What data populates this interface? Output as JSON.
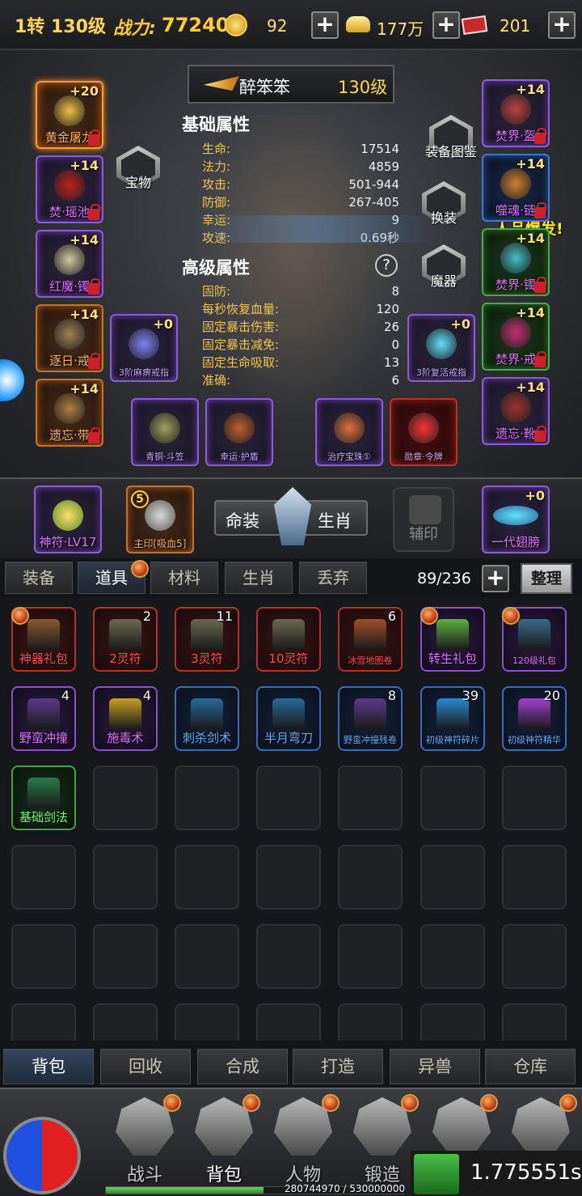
{
  "topbar": {
    "level": "1转 130级",
    "power_label": "战力:",
    "power_value": "77240",
    "currency1": "92",
    "gold": "177万",
    "voucher": "201"
  },
  "character": {
    "name": "醉笨笨",
    "level": "130级",
    "basic_title": "基础属性",
    "advanced_title": "高级属性",
    "help_icon_text": "?",
    "basic_stats": [
      {
        "k": "生命:",
        "v": "17514"
      },
      {
        "k": "法力:",
        "v": "4859"
      },
      {
        "k": "攻击:",
        "v": "501-944"
      },
      {
        "k": "防御:",
        "v": "267-405"
      },
      {
        "k": "幸运:",
        "v": "9"
      },
      {
        "k": "攻速:",
        "v": "0.69秒"
      }
    ],
    "advanced_stats": [
      {
        "k": "固防:",
        "v": "8"
      },
      {
        "k": "每秒恢复血量:",
        "v": "120"
      },
      {
        "k": "固定暴击伤害:",
        "v": "26"
      },
      {
        "k": "固定暴击减免:",
        "v": "0"
      },
      {
        "k": "固定生命吸取:",
        "v": "13"
      },
      {
        "k": "准确:",
        "v": "6"
      }
    ],
    "buttons": {
      "treasure": "宝物",
      "codex": "装备图鉴",
      "switch": "换装",
      "magic": "魔器"
    },
    "luck_banner": "人品爆发!"
  },
  "equip_left": [
    {
      "lvl": "+20",
      "name": "黄金屠龙"
    },
    {
      "lvl": "+14",
      "name": "焚·瑶池"
    },
    {
      "lvl": "+14",
      "name": "红魔·镯"
    },
    {
      "lvl": "+14",
      "name": "逐日·戒"
    },
    {
      "lvl": "+14",
      "name": "遗忘·带"
    }
  ],
  "equip_right": [
    {
      "lvl": "+14",
      "name": "焚界·盔"
    },
    {
      "lvl": "+14",
      "name": "噬魂·链"
    },
    {
      "lvl": "+14",
      "name": "焚界·镯"
    },
    {
      "lvl": "+14",
      "name": "焚界·戒"
    },
    {
      "lvl": "+14",
      "name": "遗忘·靴"
    }
  ],
  "equip_rings": [
    {
      "lvl": "+0",
      "name": "3阶麻痹戒指"
    },
    {
      "lvl": "+0",
      "name": "3阶复活戒指"
    }
  ],
  "equip_bottom": [
    {
      "name": "青铜·斗笠"
    },
    {
      "name": "幸运·护盾"
    },
    {
      "name": "治疗宝珠①"
    },
    {
      "name": "勋章·令牌"
    }
  ],
  "mid": {
    "talisman": "神符·LV17",
    "seal_num": "5",
    "seal": "主印[吸血5]",
    "fate_label": "命装",
    "zodiac_label": "生肖",
    "aux_seal": "辅印",
    "wings_lvl": "+0",
    "wings": "一代翅膀"
  },
  "bag_tabs": [
    "装备",
    "道具",
    "材料",
    "生肖",
    "丢弃"
  ],
  "bag_count": "89/236",
  "sort_label": "整理",
  "bag_items": [
    {
      "name": "神器礼包",
      "count": "",
      "color": "red",
      "ic": "#8a5a30"
    },
    {
      "name": "2灵符",
      "count": "2",
      "color": "red",
      "ic": "#6a6a50"
    },
    {
      "name": "3灵符",
      "count": "11",
      "color": "red",
      "ic": "#6a6a50"
    },
    {
      "name": "10灵符",
      "count": "",
      "color": "red",
      "ic": "#6a6a50"
    },
    {
      "name": "冰雪地图卷",
      "count": "6",
      "color": "red",
      "ic": "#a0502a"
    },
    {
      "name": "转生礼包",
      "count": "",
      "color": "purple",
      "ic": "#60b040"
    },
    {
      "name": "120级礼包",
      "count": "",
      "color": "purple",
      "ic": "#3a6a8a"
    },
    {
      "name": "野蛮冲撞",
      "count": "4",
      "color": "purple",
      "ic": "#5a3a8a"
    },
    {
      "name": "施毒术",
      "count": "4",
      "color": "purple",
      "ic": "#c8a020"
    },
    {
      "name": "刺杀剑术",
      "count": "",
      "color": "blue",
      "ic": "#2a6a9a"
    },
    {
      "name": "半月弯刀",
      "count": "",
      "color": "blue",
      "ic": "#2a6a9a"
    },
    {
      "name": "野蛮冲撞残卷",
      "count": "8",
      "color": "blue",
      "ic": "#5a3a8a"
    },
    {
      "name": "初级神符碎片",
      "count": "39",
      "color": "blue",
      "ic": "#2a8ad0"
    },
    {
      "name": "初级神符精华",
      "count": "20",
      "color": "blue",
      "ic": "#a040d0"
    },
    {
      "name": "基础剑法",
      "count": "",
      "color": "green",
      "ic": "#2a7a4a"
    }
  ],
  "sub_tabs": [
    "背包",
    "回收",
    "合成",
    "打造",
    "异兽",
    "仓库"
  ],
  "nav": [
    "战斗",
    "背包",
    "人物",
    "锻造"
  ],
  "exp_text": "280744970 / 530000000",
  "timer": "1.775551s"
}
